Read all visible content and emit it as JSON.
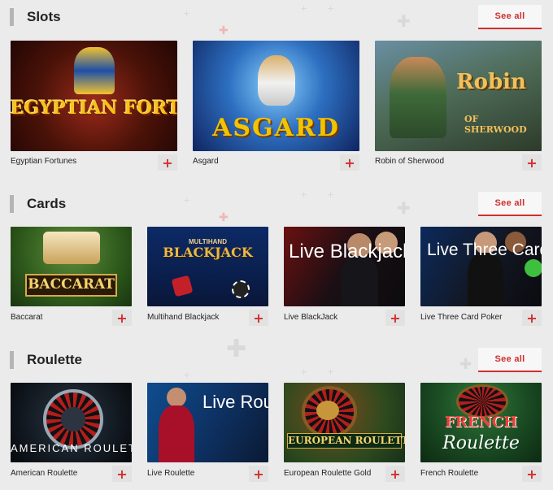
{
  "sections": [
    {
      "title": "Slots",
      "see_all_label": "See all",
      "games": [
        {
          "name": "Egyptian Fortunes",
          "thumb_title": "EGYPTIAN FORTUNES"
        },
        {
          "name": "Asgard",
          "thumb_title": "ASGARD"
        },
        {
          "name": "Robin of Sherwood",
          "thumb_title": "Robin",
          "thumb_sub": "OF SHERWOOD"
        }
      ]
    },
    {
      "title": "Cards",
      "see_all_label": "See all",
      "games": [
        {
          "name": "Baccarat",
          "thumb_title": "BACCARAT"
        },
        {
          "name": "Multihand Blackjack",
          "thumb_title": "BLACKJACK",
          "thumb_sub": "MULTIHAND"
        },
        {
          "name": "Live BlackJack",
          "thumb_title": "Live Blackjack"
        },
        {
          "name": "Live Three Card Poker",
          "thumb_title": "Live Three Card Poker"
        }
      ]
    },
    {
      "title": "Roulette",
      "see_all_label": "See all",
      "games": [
        {
          "name": "American Roulette",
          "thumb_title": "AMERICAN ROULETTE"
        },
        {
          "name": "Live Roulette",
          "thumb_title": "Live Roulette"
        },
        {
          "name": "European Roulette Gold",
          "thumb_title": "EUROPEAN ROULETTE GOLD SERIES"
        },
        {
          "name": "French Roulette",
          "thumb_title": "FRENCH",
          "thumb_sub": "Roulette"
        }
      ]
    }
  ],
  "add_button_glyph": "+",
  "colors": {
    "accent": "#d12d2d",
    "background": "#ebebeb"
  },
  "icons": {
    "add": "plus-icon"
  }
}
